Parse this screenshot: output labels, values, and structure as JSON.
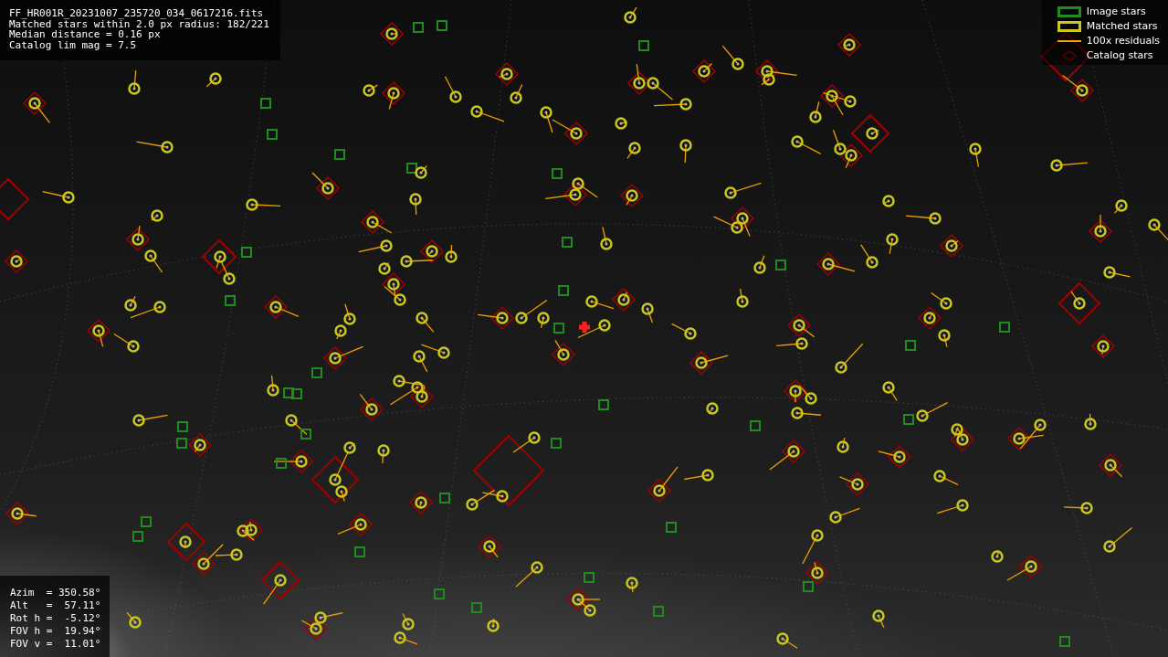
{
  "info": {
    "lines": [
      "FF_HR001R_20231007_235720_034_0617216.fits",
      "Matched stars within 2.0 px radius: 182/221",
      "Median distance = 0.16 px",
      "Catalog lim mag = 7.5"
    ]
  },
  "legend": [
    {
      "kind": "box",
      "label": "Image stars",
      "color": "#1e8c1e"
    },
    {
      "kind": "box",
      "label": "Matched stars",
      "color": "#c8c81e"
    },
    {
      "kind": "line",
      "label": "100x residuals",
      "color": "#f0a000"
    },
    {
      "kind": "diamond",
      "label": "Catalog stars",
      "color": "#5a0000"
    }
  ],
  "pointing": {
    "lines": [
      "Azim  = 350.58°",
      "Alt   =  57.11°",
      "Rot h =  -5.12°",
      "FOV h =  19.94°",
      "FOV v =  11.01°"
    ]
  }
}
